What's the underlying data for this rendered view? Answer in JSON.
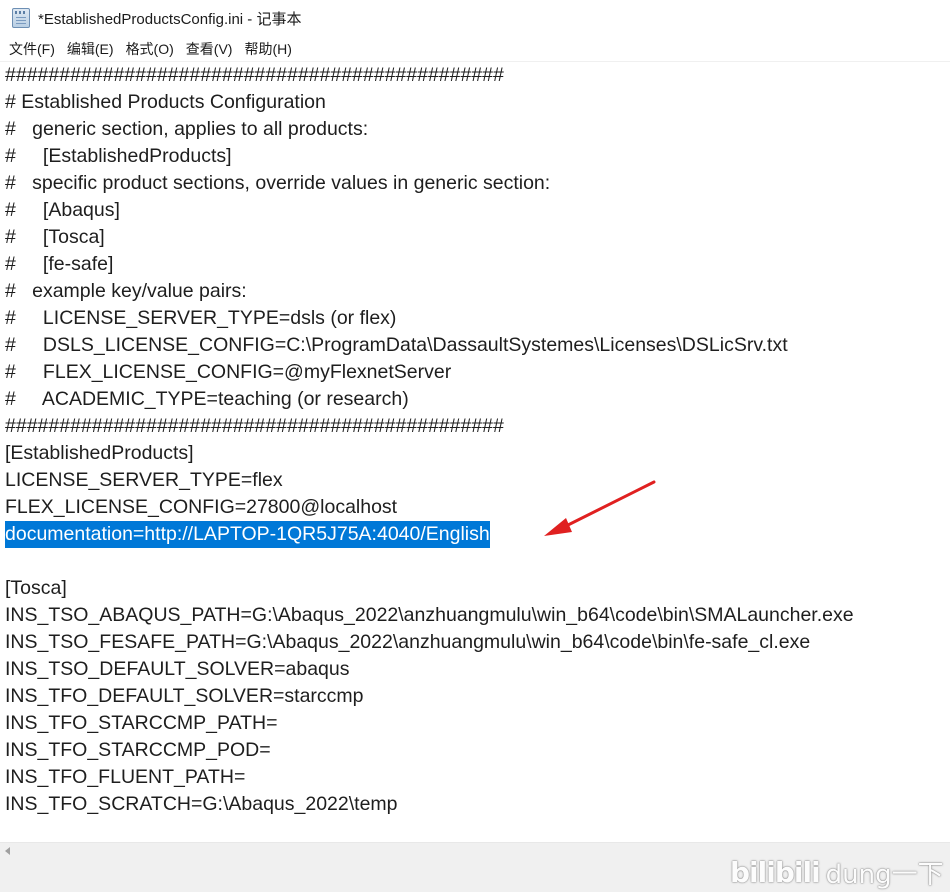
{
  "window": {
    "title": "*EstablishedProductsConfig.ini - 记事本",
    "icon": "notepad-icon"
  },
  "menu": {
    "items": [
      "文件(F)",
      "编辑(E)",
      "格式(O)",
      "查看(V)",
      "帮助(H)"
    ]
  },
  "editor": {
    "lines": [
      "##############################################",
      "# Established Products Configuration",
      "#   generic section, applies to all products:",
      "#     [EstablishedProducts]",
      "#   specific product sections, override values in generic section:",
      "#     [Abaqus]",
      "#     [Tosca]",
      "#     [fe-safe]",
      "#   example key/value pairs:",
      "#     LICENSE_SERVER_TYPE=dsls (or flex)",
      "#     DSLS_LICENSE_CONFIG=C:\\ProgramData\\DassaultSystemes\\Licenses\\DSLicSrv.txt",
      "#     FLEX_LICENSE_CONFIG=@myFlexnetServer",
      "#     ACADEMIC_TYPE=teaching (or research)",
      "##############################################",
      "[EstablishedProducts]",
      "LICENSE_SERVER_TYPE=flex",
      "FLEX_LICENSE_CONFIG=27800@localhost",
      "documentation=http://LAPTOP-1QR5J75A:4040/English",
      "",
      "[Tosca]",
      "INS_TSO_ABAQUS_PATH=G:\\Abaqus_2022\\anzhuangmulu\\win_b64\\code\\bin\\SMALauncher.exe",
      "INS_TSO_FESAFE_PATH=G:\\Abaqus_2022\\anzhuangmulu\\win_b64\\code\\bin\\fe-safe_cl.exe",
      "INS_TSO_DEFAULT_SOLVER=abaqus",
      "INS_TFO_DEFAULT_SOLVER=starccmp",
      "INS_TFO_STARCCMP_PATH=",
      "INS_TFO_STARCCMP_POD=",
      "INS_TFO_FLUENT_PATH=",
      "INS_TFO_SCRATCH=G:\\Abaqus_2022\\temp"
    ],
    "selected_line": "documentation=http://LAPTOP-1QR5J75A:4040/English",
    "selection_color": "#0078d7"
  },
  "annotation": {
    "arrow_color": "#e02020"
  },
  "watermark": {
    "logo": "bilibili",
    "name": "dung一下"
  }
}
